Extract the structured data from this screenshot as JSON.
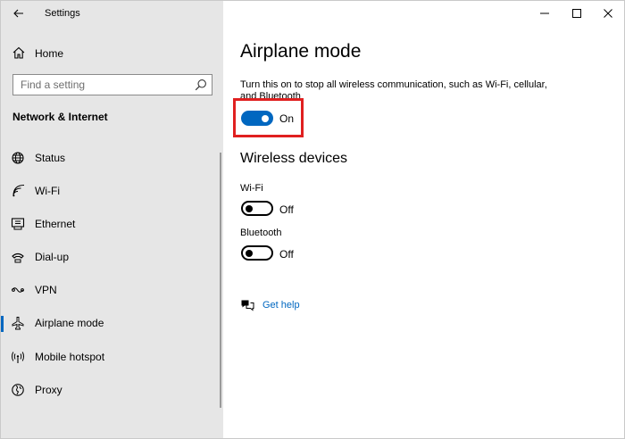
{
  "window": {
    "title": "Settings"
  },
  "sidebar": {
    "home_label": "Home",
    "search_placeholder": "Find a setting",
    "section_title": "Network & Internet",
    "items": [
      {
        "label": "Status",
        "icon": "globe-icon"
      },
      {
        "label": "Wi-Fi",
        "icon": "wifi-icon"
      },
      {
        "label": "Ethernet",
        "icon": "ethernet-icon"
      },
      {
        "label": "Dial-up",
        "icon": "dialup-icon"
      },
      {
        "label": "VPN",
        "icon": "vpn-icon"
      },
      {
        "label": "Airplane mode",
        "icon": "airplane-icon",
        "active": true
      },
      {
        "label": "Mobile hotspot",
        "icon": "hotspot-icon"
      },
      {
        "label": "Proxy",
        "icon": "proxy-icon"
      }
    ]
  },
  "main": {
    "title": "Airplane mode",
    "description": "Turn this on to stop all wireless communication, such as Wi-Fi, cellular, and Bluetooth",
    "airplane_toggle": {
      "state_label": "On",
      "on": true
    },
    "wireless_title": "Wireless devices",
    "wifi": {
      "label": "Wi-Fi",
      "state_label": "Off",
      "on": false
    },
    "bluetooth": {
      "label": "Bluetooth",
      "state_label": "Off",
      "on": false
    },
    "help_label": "Get help"
  },
  "colors": {
    "accent": "#0067c0",
    "highlight": "#e02020",
    "sidebar_bg": "#e6e6e6"
  }
}
